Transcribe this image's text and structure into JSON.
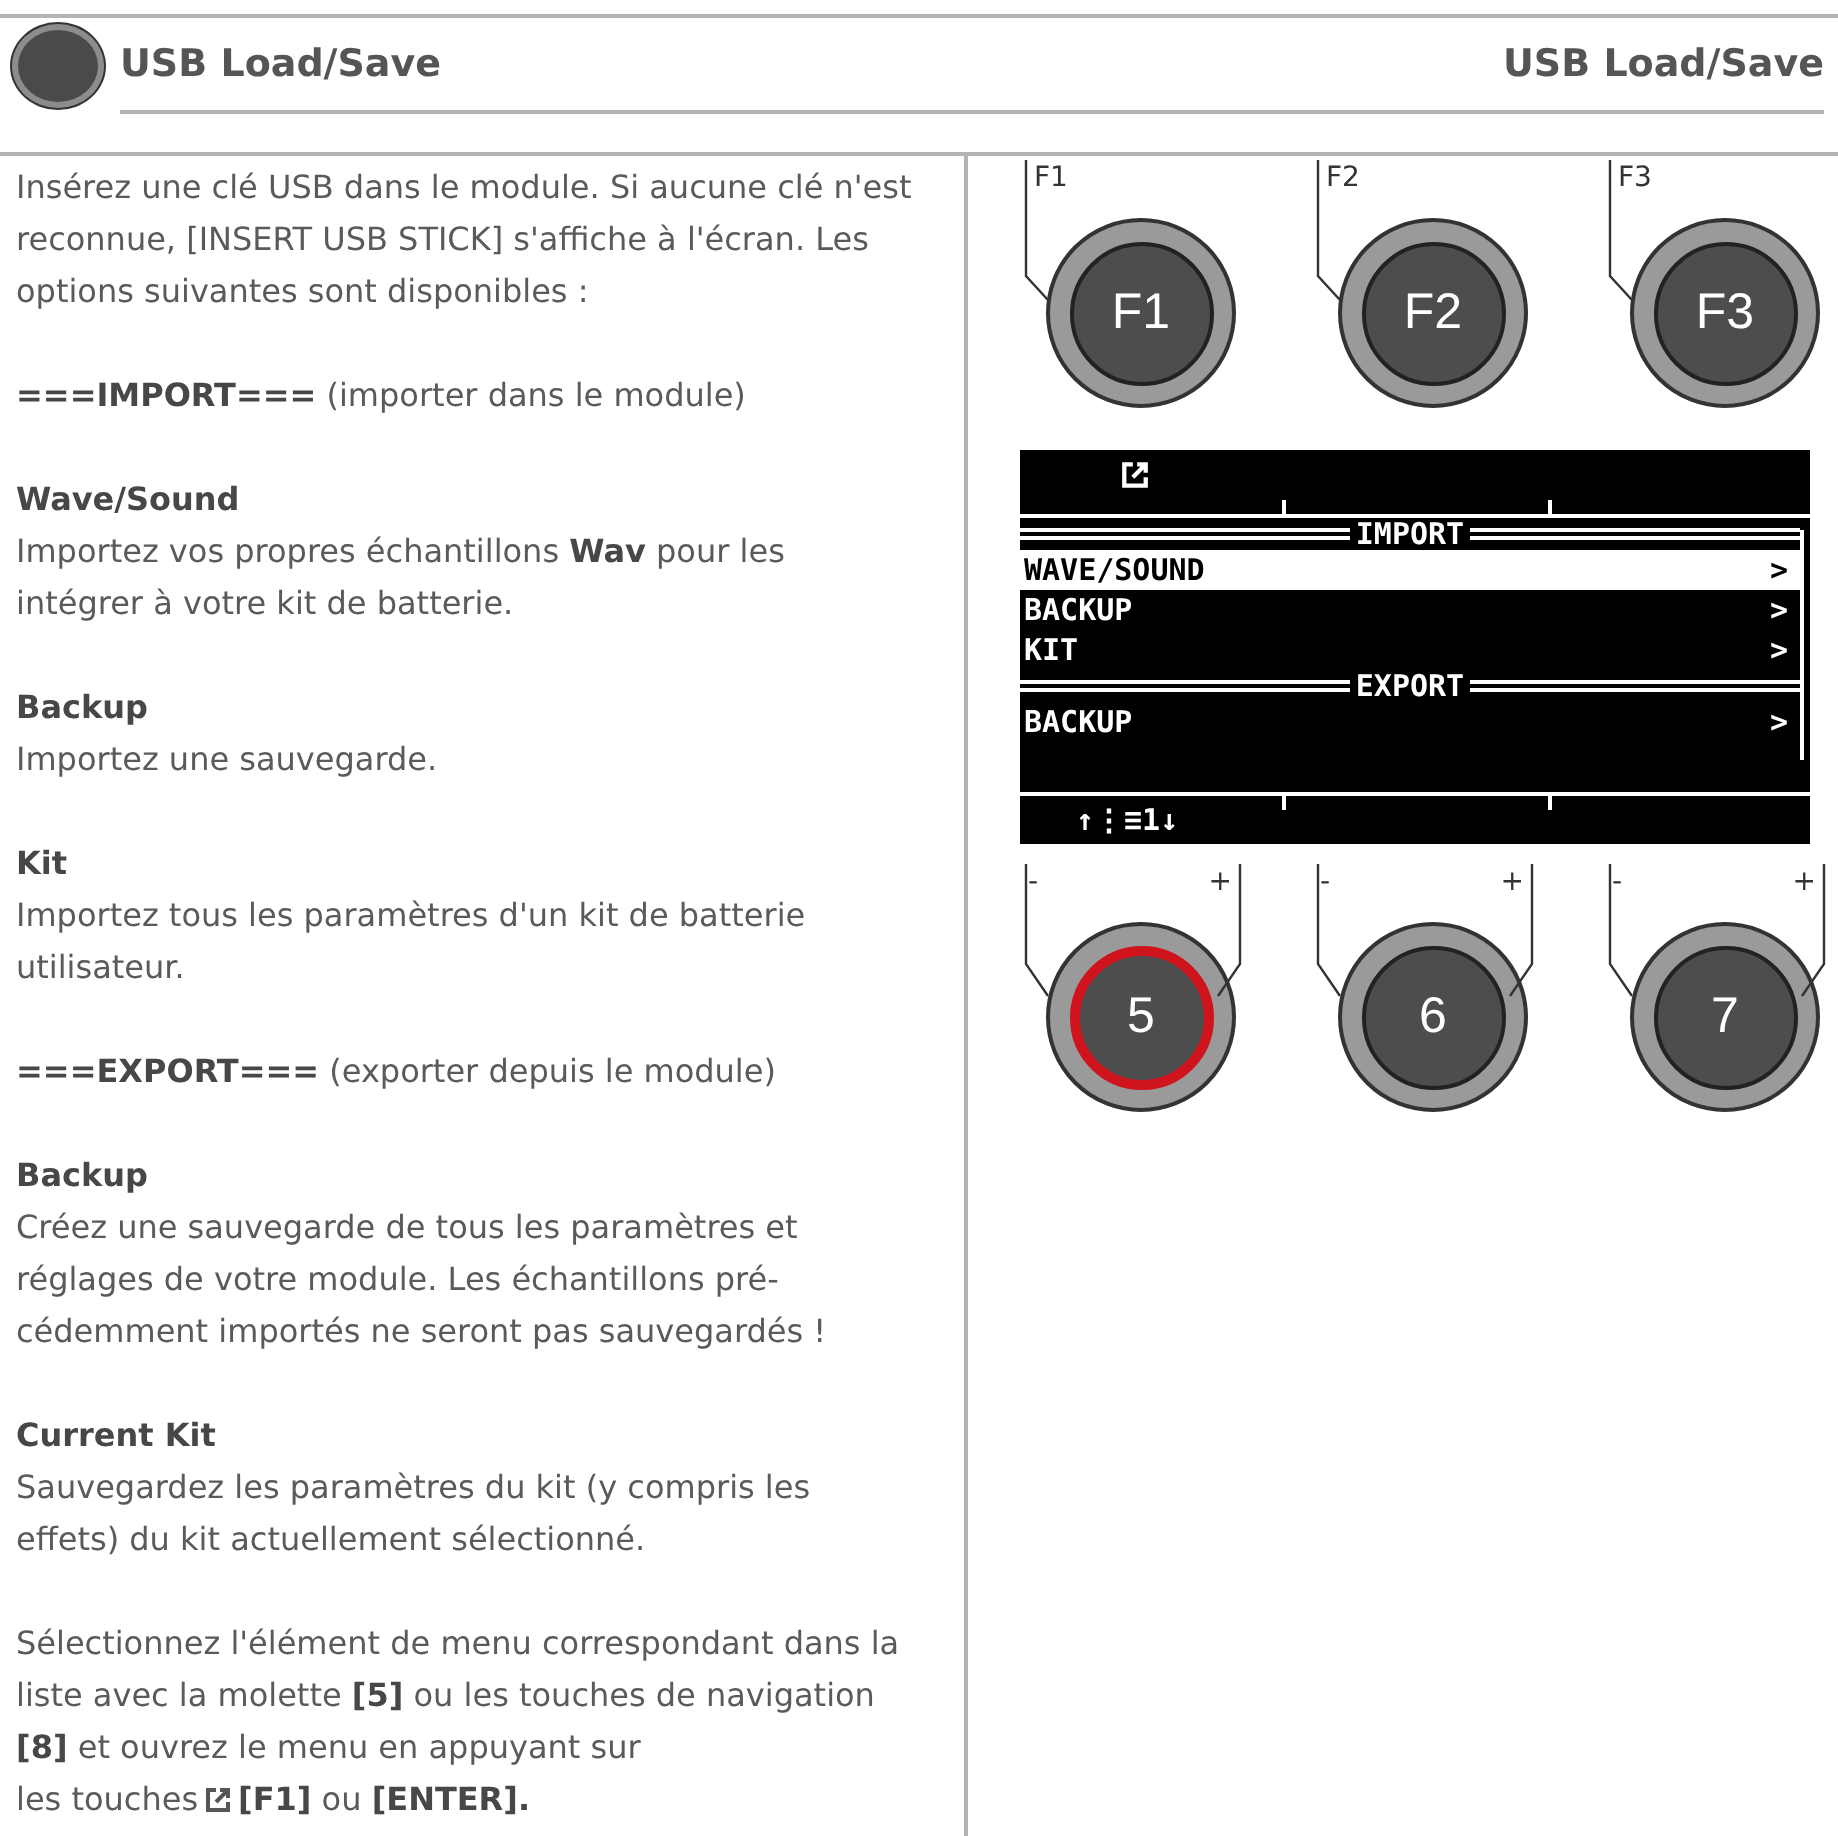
{
  "header": {
    "title": "USB Load/Save",
    "title_right": "USB Load/Save"
  },
  "blocks": [
    {
      "kind": "text",
      "text": "Insérez une clé USB dans le module. Si aucune clé n'est reconnue, [INSERT USB STICK] s'affiche à l'écran. Les options suivantes sont disponibles :"
    },
    {
      "kind": "text",
      "text": "**===IMPORT===** (importer dans le module)"
    },
    {
      "kind": "entry",
      "heading": "Wave/Sound",
      "text": "Importez vos propres échantillons **Wav** pour les intégrer à votre kit de batterie."
    },
    {
      "kind": "entry",
      "heading": "Backup",
      "text": "Importez une sauvegarde."
    },
    {
      "kind": "entry",
      "heading": "Kit",
      "text": "Importez tous les paramètres d'un kit de batterie utilisateur."
    },
    {
      "kind": "text",
      "text": "**===EXPORT===** (exporter depuis le module)"
    },
    {
      "kind": "entry",
      "heading": "Backup",
      "text": "Créez une sauvegarde de tous les paramètres et réglages de votre module. Les échantillons pré-cédemment importés ne seront pas sauvegardés !"
    },
    {
      "kind": "entry",
      "heading": "Current Kit",
      "text": "Sauvegardez les paramètres du kit (y compris les effets) du kit actuellement sélectionné."
    },
    {
      "kind": "text_icon",
      "text": "Sélectionnez l'élément de menu correspondant dans la liste avec la molette **[5]** ou les touches de navigation **[8]** et ouvrez le menu en appuyant sur",
      "last_line": "les touches",
      "after": "**[F1]** ou **[ENTER].**"
    }
  ],
  "device": {
    "function_buttons": [
      {
        "caption": "F1",
        "label": "F1"
      },
      {
        "caption": "F2",
        "label": "F2"
      },
      {
        "caption": "F3",
        "label": "F3"
      }
    ],
    "screen": {
      "rows": [
        {
          "kind": "section",
          "label": "IMPORT"
        },
        {
          "kind": "item",
          "label": "WAVE/SOUND",
          "arrow": ">",
          "selected": true
        },
        {
          "kind": "item",
          "label": "BACKUP",
          "arrow": ">",
          "selected": false
        },
        {
          "kind": "item",
          "label": "KIT",
          "arrow": ">",
          "selected": false
        },
        {
          "kind": "section",
          "label": "EXPORT"
        },
        {
          "kind": "item",
          "label": "BACKUP",
          "arrow": ">",
          "selected": false
        }
      ],
      "footer": "↑⋮≡1↓"
    },
    "knobs": [
      {
        "label": "5",
        "minus": "-",
        "plus": "+",
        "selected": true
      },
      {
        "label": "6",
        "minus": "-",
        "plus": "+",
        "selected": false
      },
      {
        "label": "7",
        "minus": "-",
        "plus": "+",
        "selected": false
      }
    ]
  }
}
